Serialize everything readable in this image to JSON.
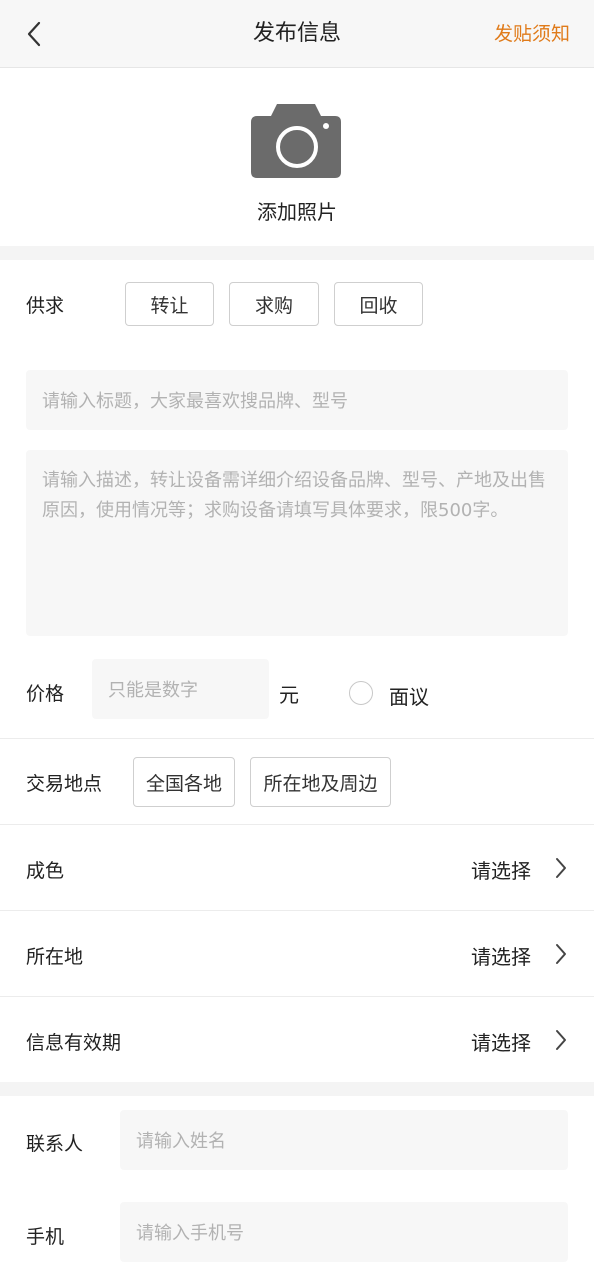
{
  "header": {
    "title": "发布信息",
    "notice_link": "发贴须知"
  },
  "photo": {
    "label": "添加照片"
  },
  "supply_demand": {
    "label": "供求",
    "options": [
      "转让",
      "求购",
      "回收"
    ]
  },
  "title_input": {
    "placeholder": "请输入标题，大家最喜欢搜品牌、型号"
  },
  "description_input": {
    "placeholder": "请输入描述，转让设备需详细介绍设备品牌、型号、产地及出售原因，使用情况等；求购设备请填写具体要求，限500字。"
  },
  "price": {
    "label": "价格",
    "placeholder": "只能是数字",
    "unit": "元",
    "negotiable_label": "面议"
  },
  "trade_location": {
    "label": "交易地点",
    "options": [
      "全国各地",
      "所在地及周边"
    ]
  },
  "select_rows": [
    {
      "label": "成色",
      "value": "请选择"
    },
    {
      "label": "所在地",
      "value": "请选择"
    },
    {
      "label": "信息有效期",
      "value": "请选择"
    }
  ],
  "contact": {
    "label": "联系人",
    "placeholder": "请输入姓名"
  },
  "phone": {
    "label": "手机",
    "placeholder": "请输入手机号"
  },
  "colors": {
    "accent": "#e07b1a",
    "camera": "#6b6b6b"
  }
}
